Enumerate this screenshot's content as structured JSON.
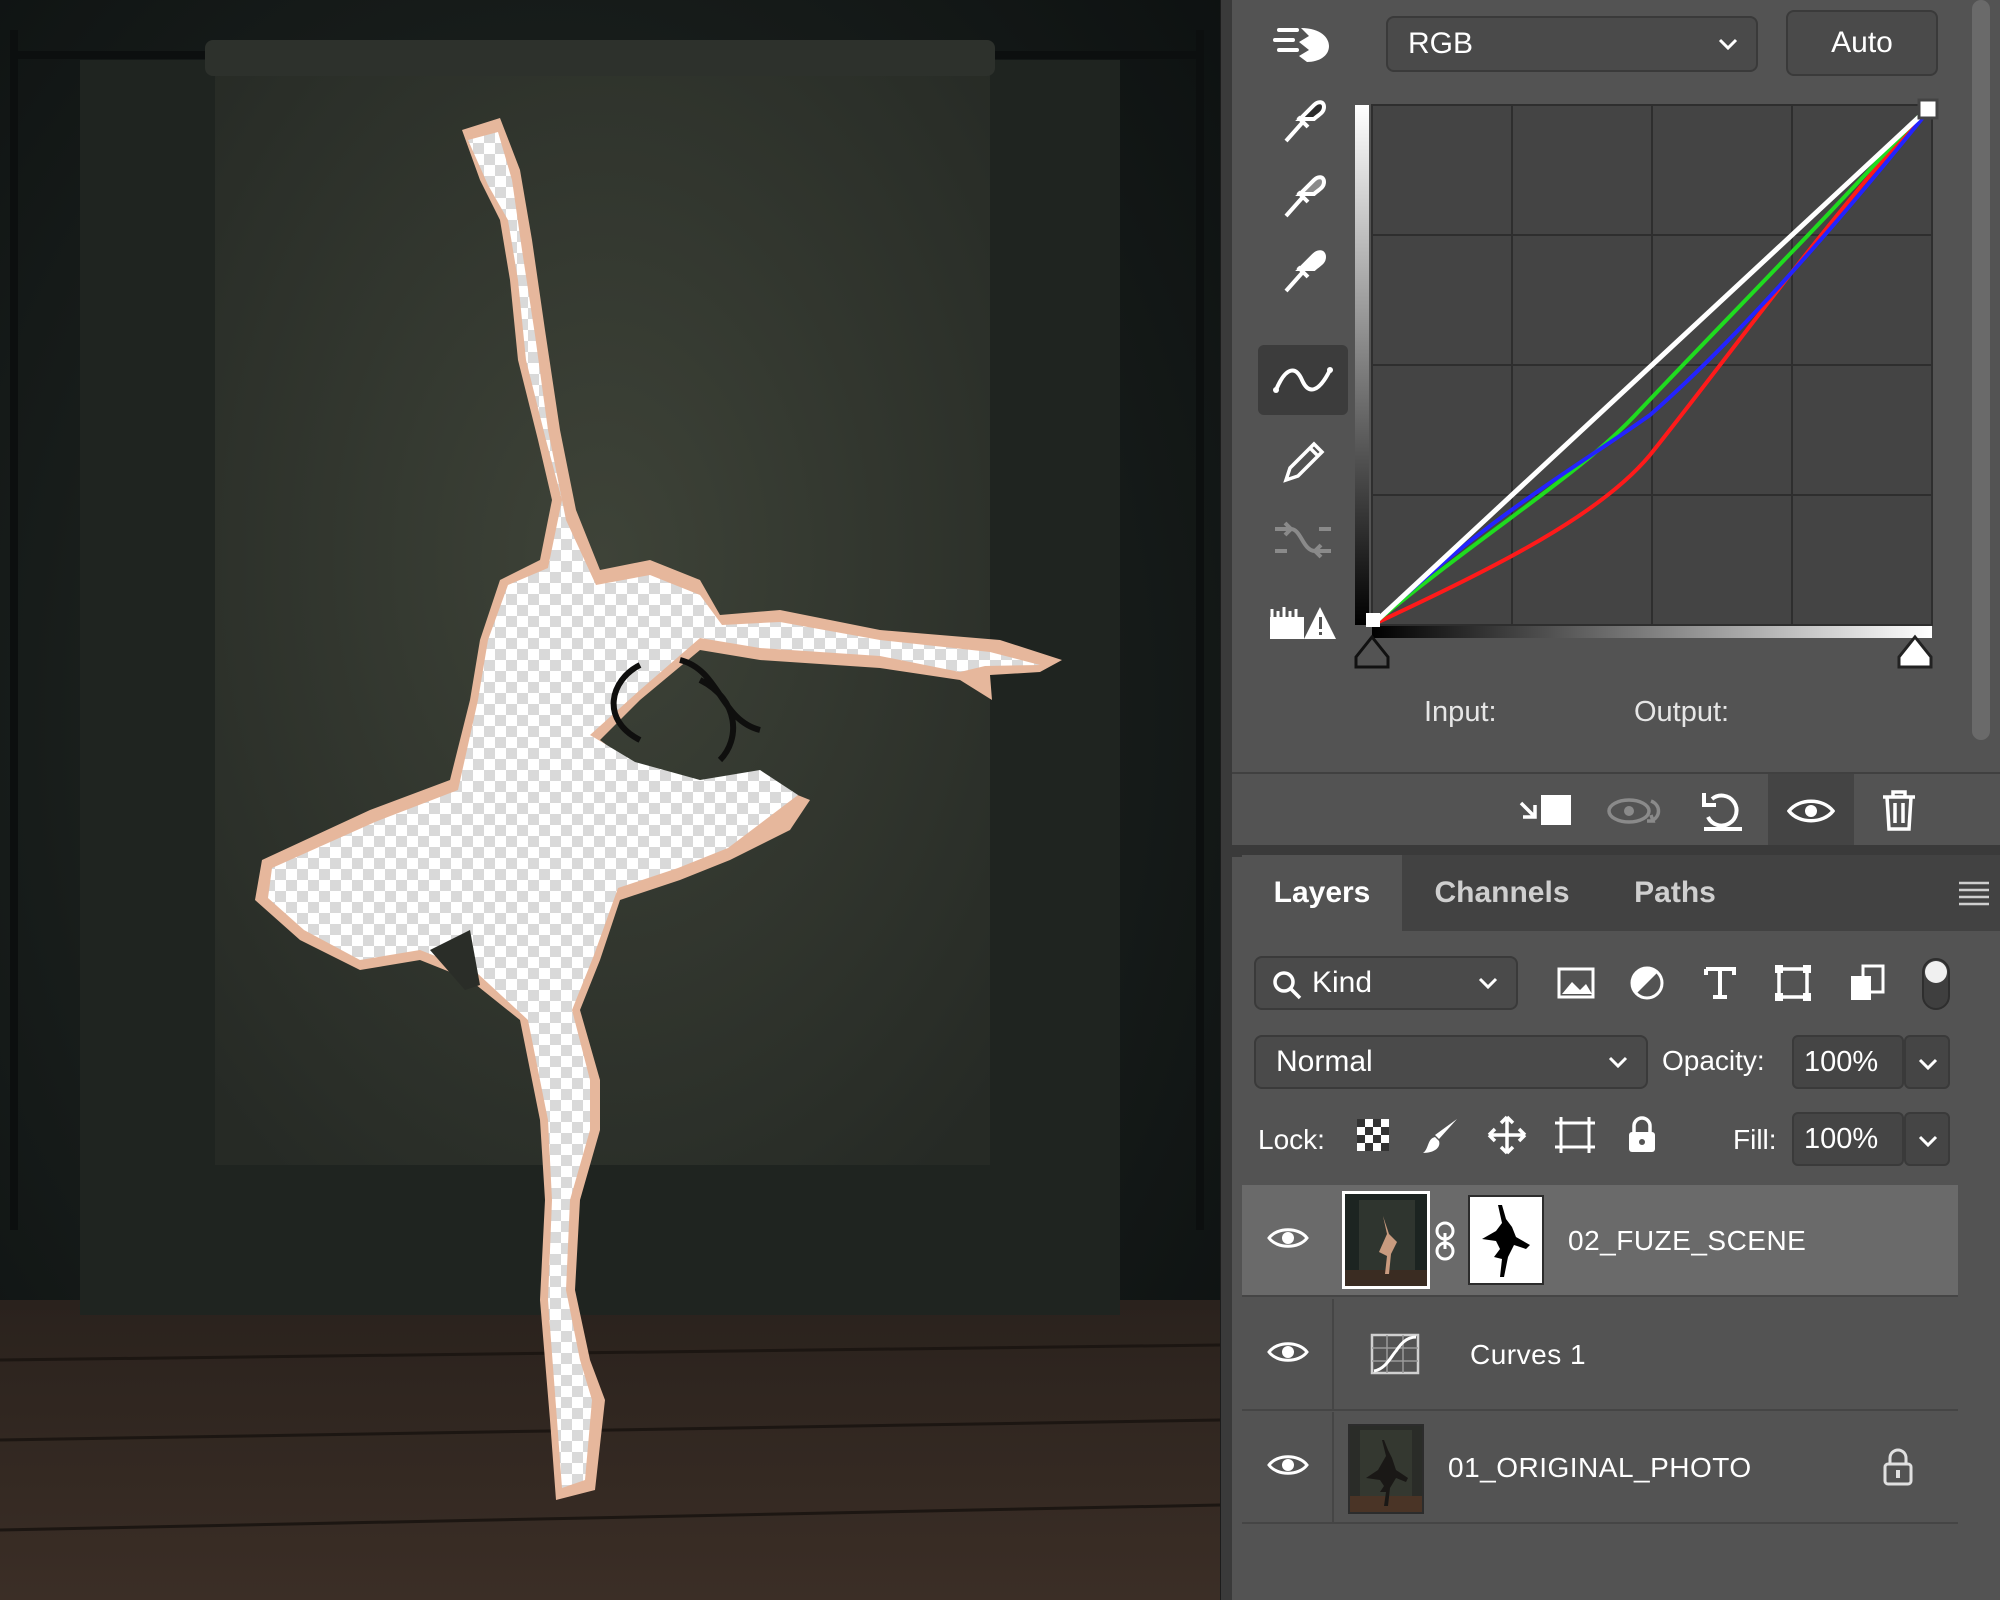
{
  "properties": {
    "channel_select": "RGB",
    "auto_button": "Auto",
    "input_label": "Input:",
    "output_label": "Output:"
  },
  "layers_panel": {
    "tabs": [
      "Layers",
      "Channels",
      "Paths"
    ],
    "active_tab": "Layers",
    "filter_kind": "Kind",
    "blend_mode": "Normal",
    "opacity_label": "Opacity:",
    "opacity_value": "100%",
    "lock_label": "Lock:",
    "fill_label": "Fill:",
    "fill_value": "100%",
    "layers": [
      {
        "name": "02_FUZE_SCENE",
        "type": "pixel-with-mask",
        "visible": true,
        "selected": true
      },
      {
        "name": "Curves 1",
        "type": "curves-adjustment",
        "visible": true,
        "selected": false
      },
      {
        "name": "01_ORIGINAL_PHOTO",
        "type": "pixel",
        "visible": true,
        "selected": false,
        "locked": true
      }
    ]
  },
  "colors": {
    "panel_bg": "#535353",
    "dark_bg": "#3a3a3a",
    "curve_red": "#ff1a1a",
    "curve_green": "#1fdc1f",
    "curve_blue": "#2323ff",
    "curve_rgb": "#ffffff"
  },
  "icons": [
    "targeted-adjustment-icon",
    "black-eyedropper-icon",
    "gray-eyedropper-icon",
    "white-eyedropper-icon",
    "curve-point-icon",
    "pencil-icon",
    "smooth-icon",
    "clipping-warning-icon",
    "clip-to-layer-icon",
    "view-previous-icon",
    "reset-icon",
    "visibility-icon",
    "trash-icon",
    "search-icon",
    "panel-menu-icon"
  ]
}
